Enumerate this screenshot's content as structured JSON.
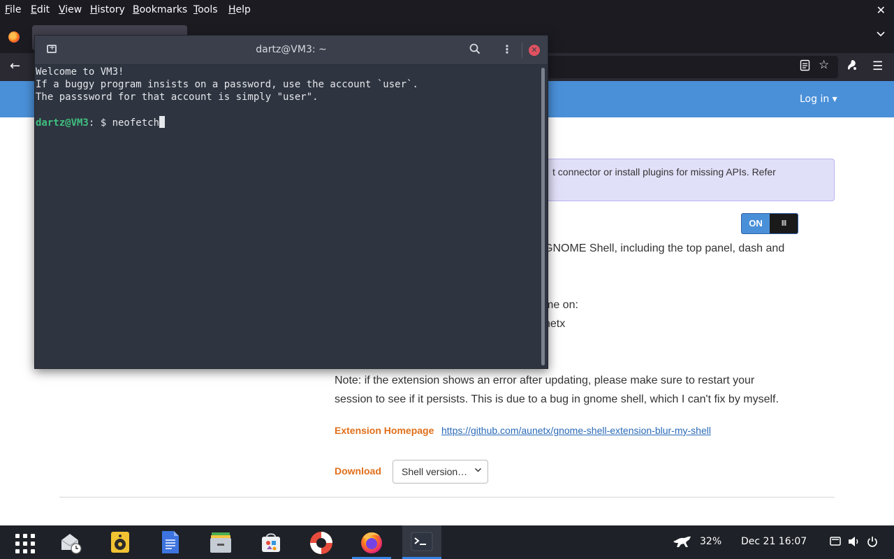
{
  "menubar": {
    "items": [
      "File",
      "Edit",
      "View",
      "History",
      "Bookmarks",
      "Tools",
      "Help"
    ],
    "close_icon": "close-icon"
  },
  "webpage": {
    "login_label": "Log in ▾",
    "alert_text": "t connector or install plugins for missing APIs. Refer",
    "toggle_on_label": "ON",
    "toggle_knob_label": "III",
    "desc_line1": "GNOME Shell, including the top panel, dash and",
    "desc_line2": "me on:",
    "desc_line3": "netx",
    "note_line1": "Note: if the extension shows an error after updating, please make sure to restart your",
    "note_line2": "session to see if it persists. This is due to a bug in gnome shell, which I can't fix by myself.",
    "homepage_label": "Extension Homepage",
    "homepage_url": "https://github.com/aunetx/gnome-shell-extension-blur-my-shell",
    "download_label": "Download",
    "shell_version_selected": "Shell version…"
  },
  "terminal": {
    "title": "dartz@VM3: ~",
    "lines": [
      "Welcome to VM3!",
      "If a buggy program insists on a password, use the account `user`.",
      "The passsword for that account is simply \"user\"."
    ],
    "prompt_user": "dartz@VM3",
    "prompt_rest": ": $ ",
    "command": "neofetch"
  },
  "taskbar": {
    "battery": "32%",
    "clock": "Dec 21  16:07",
    "running_apps": [
      "firefox",
      "terminal"
    ],
    "active_app": "terminal"
  },
  "colors": {
    "accent": "#4a90d9",
    "link_orange": "#e06f1a",
    "prompt_green": "#3fbf7f",
    "close_red": "#e05260"
  }
}
